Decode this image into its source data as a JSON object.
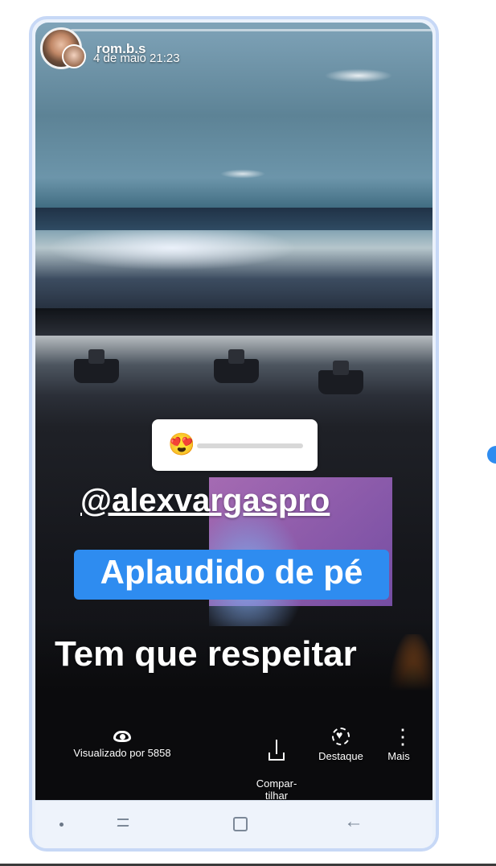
{
  "story": {
    "username": "rom.b.s",
    "timestamp": "4 de maio 21:23",
    "slider_emoji": "😍",
    "mention": "@alexvargaspro",
    "badge_text": "Aplaudido de pé",
    "caption": "Tem que respeitar"
  },
  "actions": {
    "views_label": "Visualizado por 5858",
    "share_label": "Compar-\ntilhar",
    "highlight_label": "Destaque",
    "more_label": "Mais"
  },
  "colors": {
    "accent": "#2e8cf0",
    "frame": "#c7d8f6"
  }
}
